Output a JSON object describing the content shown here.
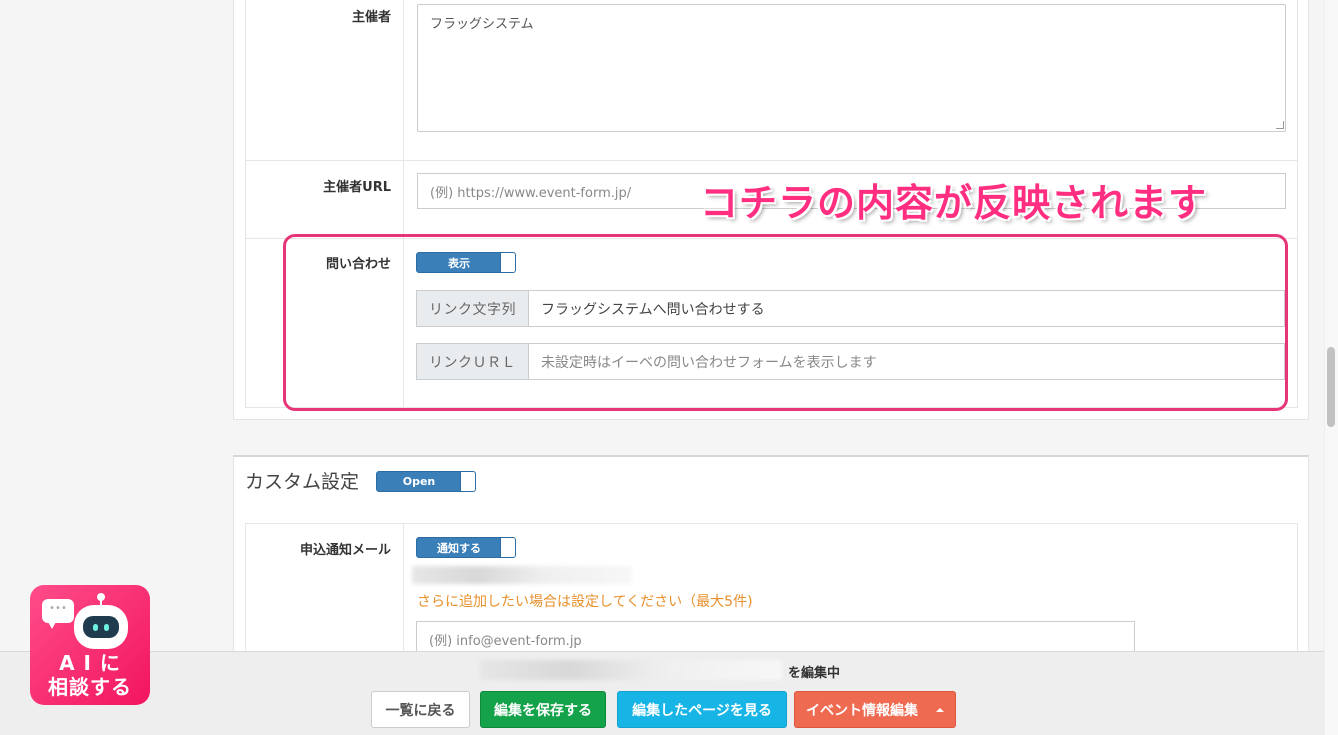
{
  "organizer": {
    "label": "主催者",
    "value": "フラッグシステム"
  },
  "organizer_url": {
    "label": "主催者URL",
    "placeholder": "(例) https://www.event-form.jp/"
  },
  "contact": {
    "label": "問い合わせ",
    "toggle_label": "表示",
    "link_text_label": "リンク文字列",
    "link_text_value": "フラッグシステムへ問い合わせする",
    "link_url_label": "リンクＵＲＬ",
    "link_url_placeholder": "未設定時はイーベの問い合わせフォームを表示します"
  },
  "annotation": "コチラの内容が反映されます",
  "custom_settings": {
    "title": "カスタム設定",
    "toggle_label": "Open"
  },
  "notify_mail": {
    "label": "申込通知メール",
    "toggle_label": "通知する",
    "hint": "さらに追加したい場合は設定してください（最大5件)",
    "placeholder": "(例) info@event-form.jp"
  },
  "bottom_bar": {
    "editing_suffix": "を編集中",
    "back_label": "一覧に戻る",
    "save_label": "編集を保存する",
    "view_label": "編集したページを見る",
    "event_label": "イベント情報編集"
  },
  "ai_widget": {
    "line1": "A I に",
    "line2": "相談する",
    "bubble": "•••"
  },
  "colors": {
    "annotation": "#ff2e80",
    "toggle": "#3b7fb9",
    "save": "#14a24a",
    "view": "#17b5e6",
    "event": "#ee6b52",
    "hint": "#e8902c"
  }
}
